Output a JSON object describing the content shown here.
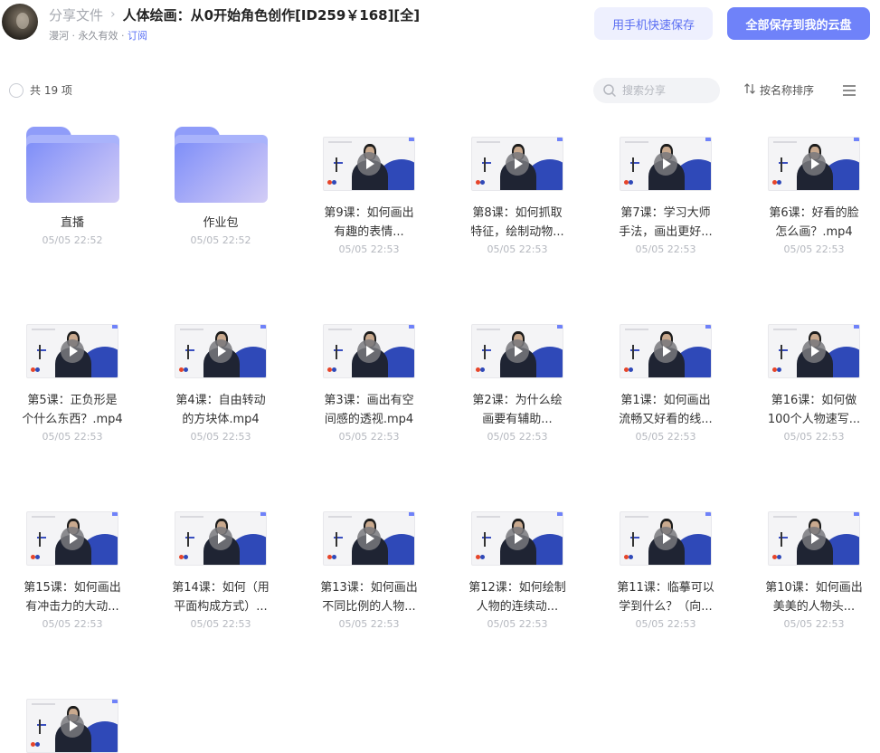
{
  "header": {
    "breadcrumb_parent": "分享文件",
    "breadcrumb_separator": "›",
    "title": "人体绘画：从0开始角色创作[ID259￥168][全]",
    "sharer": "漫河",
    "validity": "永久有效",
    "subscribe": "订阅",
    "dot": "·"
  },
  "actions": {
    "save_phone": "用手机快速保存",
    "save_all": "全部保存到我的云盘"
  },
  "toolbar": {
    "count": "共 19 项",
    "search_placeholder": "搜索分享",
    "sort": "按名称排序"
  },
  "icons": {
    "search": "search-icon",
    "sort": "sort-icon",
    "list": "list-view-icon",
    "play": "play-icon",
    "folder": "folder-icon"
  },
  "colors": {
    "accent": "#6f82f9",
    "accent_light": "#eef0fe",
    "link": "#5b72f5",
    "folder": "#8f9cf9"
  },
  "items": [
    {
      "type": "folder",
      "name_lines": [
        "直播"
      ],
      "time": "05/05 22:52"
    },
    {
      "type": "folder",
      "name_lines": [
        "作业包"
      ],
      "time": "05/05 22:52"
    },
    {
      "type": "video",
      "name_lines": [
        "第9课：如何画出",
        "有趣的表情..."
      ],
      "time": "05/05 22:53"
    },
    {
      "type": "video",
      "name_lines": [
        "第8课：如何抓取",
        "特征，绘制动物..."
      ],
      "time": "05/05 22:53"
    },
    {
      "type": "video",
      "name_lines": [
        "第7课：学习大师",
        "手法，画出更好..."
      ],
      "time": "05/05 22:53"
    },
    {
      "type": "video",
      "name_lines": [
        "第6课：好看的脸",
        "怎么画？.mp4"
      ],
      "time": "05/05 22:53"
    },
    {
      "type": "video",
      "name_lines": [
        "第5课：正负形是",
        "个什么东西？.mp4"
      ],
      "time": "05/05 22:53"
    },
    {
      "type": "video",
      "name_lines": [
        "第4课：自由转动",
        "的方块体.mp4"
      ],
      "time": "05/05 22:53"
    },
    {
      "type": "video",
      "name_lines": [
        "第3课：画出有空",
        "间感的透视.mp4"
      ],
      "time": "05/05 22:53"
    },
    {
      "type": "video",
      "name_lines": [
        "第2课：为什么绘",
        "画要有辅助..."
      ],
      "time": "05/05 22:53"
    },
    {
      "type": "video",
      "name_lines": [
        "第1课：如何画出",
        "流畅又好看的线..."
      ],
      "time": "05/05 22:53"
    },
    {
      "type": "video",
      "name_lines": [
        "第16课：如何做",
        "100个人物速写..."
      ],
      "time": "05/05 22:53"
    },
    {
      "type": "video",
      "name_lines": [
        "第15课：如何画出",
        "有冲击力的大动..."
      ],
      "time": "05/05 22:53"
    },
    {
      "type": "video",
      "name_lines": [
        "第14课：如何（用",
        "平面构成方式）..."
      ],
      "time": "05/05 22:53"
    },
    {
      "type": "video",
      "name_lines": [
        "第13课：如何画出",
        "不同比例的人物..."
      ],
      "time": "05/05 22:53"
    },
    {
      "type": "video",
      "name_lines": [
        "第12课：如何绘制",
        "人物的连续动..."
      ],
      "time": "05/05 22:53"
    },
    {
      "type": "video",
      "name_lines": [
        "第11课：临摹可以",
        "学到什么？（向..."
      ],
      "time": "05/05 22:53"
    },
    {
      "type": "video",
      "name_lines": [
        "第10课：如何画出",
        "美美的人物头..."
      ],
      "time": "05/05 22:53"
    },
    {
      "type": "video",
      "name_lines": [],
      "time": ""
    }
  ]
}
